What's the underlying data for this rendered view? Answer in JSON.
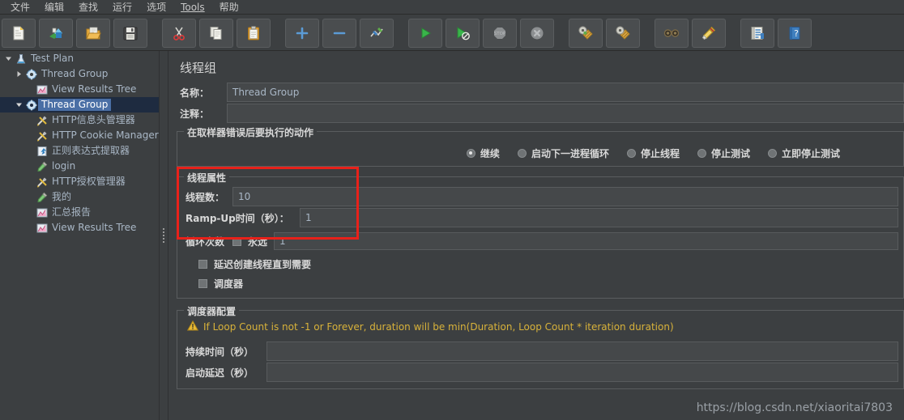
{
  "menu": {
    "items": [
      {
        "label": "文件",
        "underlined": false
      },
      {
        "label": "编辑",
        "underlined": false
      },
      {
        "label": "查找",
        "underlined": false
      },
      {
        "label": "运行",
        "underlined": false
      },
      {
        "label": "选项",
        "underlined": false
      },
      {
        "label": "Tools",
        "underlined": true
      },
      {
        "label": "帮助",
        "underlined": false
      }
    ]
  },
  "toolbar": {
    "groups": [
      [
        "new-icon",
        "templates-icon",
        "open-icon",
        "save-icon"
      ],
      [
        "cut-icon",
        "copy-icon",
        "paste-icon"
      ],
      [
        "expand-icon",
        "collapse-icon",
        "toggle-icon"
      ],
      [
        "start-icon",
        "start-no-pauses-icon",
        "stop-icon",
        "shutdown-icon"
      ],
      [
        "clear-icon",
        "clear-all-icon"
      ],
      [
        "search-icon",
        "reset-search-icon"
      ],
      [
        "log-viewer-icon",
        "help-icon"
      ]
    ]
  },
  "tree": {
    "nodes": [
      {
        "label": "Test Plan",
        "icon": "test-plan-icon",
        "indent": 0,
        "toggle": "expanded",
        "selected": false
      },
      {
        "label": "Thread Group",
        "icon": "thread-group-icon",
        "indent": 1,
        "toggle": "collapsed",
        "selected": false
      },
      {
        "label": "View Results Tree",
        "icon": "results-tree-icon",
        "indent": 2,
        "toggle": "none",
        "selected": false
      },
      {
        "label": "Thread Group",
        "icon": "thread-group-icon",
        "indent": 1,
        "toggle": "expanded",
        "selected": true
      },
      {
        "label": "HTTP信息头管理器",
        "icon": "header-manager-icon",
        "indent": 2,
        "toggle": "none",
        "selected": false
      },
      {
        "label": "HTTP Cookie Manager",
        "icon": "header-manager-icon",
        "indent": 2,
        "toggle": "none",
        "selected": false
      },
      {
        "label": "正则表达式提取器",
        "icon": "post-processor-icon",
        "indent": 2,
        "toggle": "none",
        "selected": false
      },
      {
        "label": "login",
        "icon": "sampler-icon",
        "indent": 2,
        "toggle": "none",
        "selected": false
      },
      {
        "label": "HTTP授权管理器",
        "icon": "header-manager-icon",
        "indent": 2,
        "toggle": "none",
        "selected": false
      },
      {
        "label": "我的",
        "icon": "sampler-icon",
        "indent": 2,
        "toggle": "none",
        "selected": false
      },
      {
        "label": "汇总报告",
        "icon": "results-tree-icon",
        "indent": 2,
        "toggle": "none",
        "selected": false
      },
      {
        "label": "View Results Tree",
        "icon": "results-tree-icon",
        "indent": 2,
        "toggle": "none",
        "selected": false
      }
    ]
  },
  "panel": {
    "title": "线程组",
    "name_label": "名称：",
    "name_value": "Thread Group",
    "comment_label": "注释：",
    "comment_value": "",
    "error_action": {
      "group_title": "在取样器错误后要执行的动作",
      "options": [
        {
          "label": "继续",
          "selected": true
        },
        {
          "label": "启动下一进程循环",
          "selected": false
        },
        {
          "label": "停止线程",
          "selected": false
        },
        {
          "label": "停止测试",
          "selected": false
        },
        {
          "label": "立即停止测试",
          "selected": false
        }
      ]
    },
    "thread_properties": {
      "group_title": "线程属性",
      "threads_label": "线程数：",
      "threads_value": "10",
      "rampup_label": "Ramp-Up时间（秒）：",
      "rampup_value": "1"
    },
    "loop": {
      "label": "循环次数",
      "forever_label": "永远",
      "forever_checked": false,
      "value": "1"
    },
    "delay_create_label": "延迟创建线程直到需要",
    "delay_create_checked": false,
    "scheduler_label": "调度器",
    "scheduler_checked": false,
    "scheduler_config": {
      "group_title": "调度器配置",
      "warning": "If Loop Count is not -1 or Forever, duration will be min(Duration, Loop Count * iteration duration)",
      "duration_label": "持续时间（秒）",
      "duration_value": "",
      "startup_delay_label": "启动延迟（秒）",
      "startup_delay_value": ""
    }
  },
  "annotation": {
    "color": "#e8211a"
  },
  "watermark": "https://blog.csdn.net/xiaoritai7803"
}
